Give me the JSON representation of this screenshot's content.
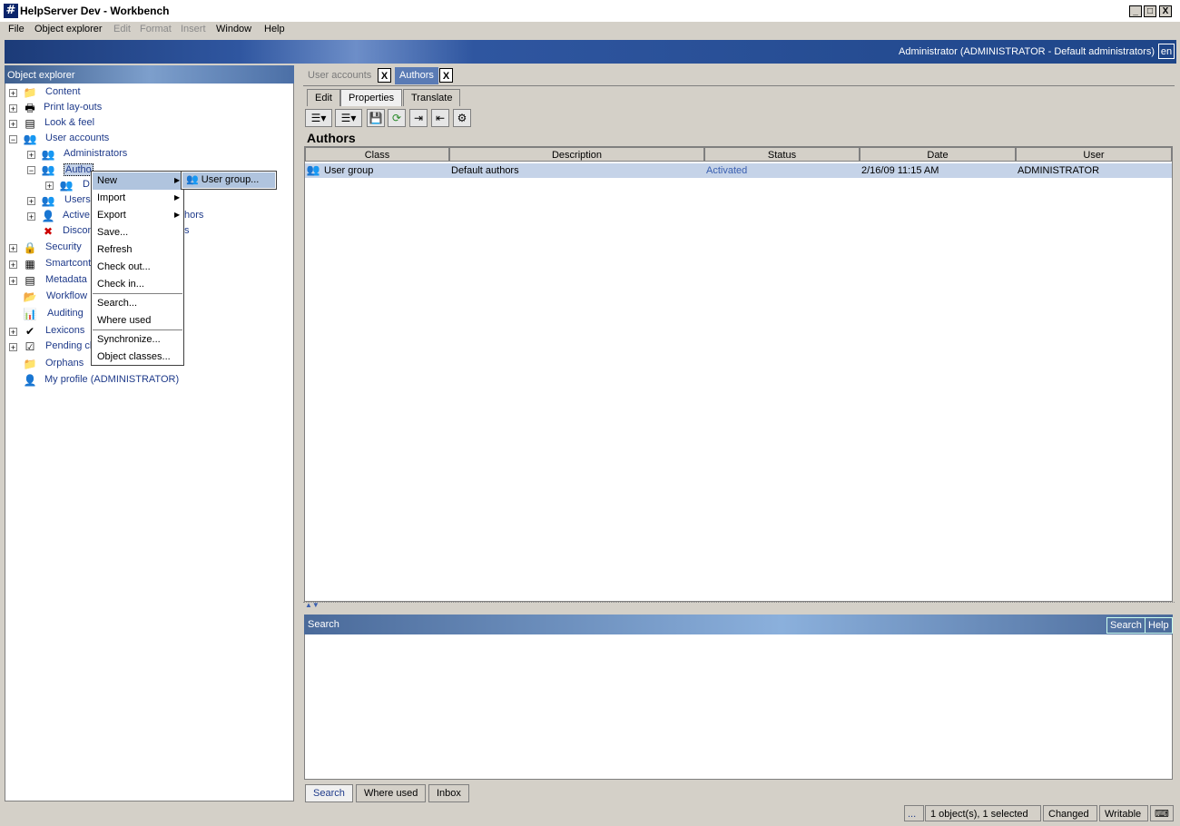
{
  "window": {
    "title": "HelpServer Dev - Workbench",
    "app_icon": "#",
    "min": "_",
    "max": "□",
    "close": "X"
  },
  "menubar": [
    {
      "label": "File",
      "enabled": true
    },
    {
      "label": "Object explorer",
      "enabled": true
    },
    {
      "label": "Edit",
      "enabled": false
    },
    {
      "label": "Format",
      "enabled": false
    },
    {
      "label": "Insert",
      "enabled": false
    },
    {
      "label": "Window",
      "enabled": true
    },
    {
      "label": "Help",
      "enabled": true
    }
  ],
  "banner": {
    "user": "Administrator (ADMINISTRATOR - Default administrators)",
    "lang": "en"
  },
  "explorer": {
    "title": "Object explorer",
    "items": [
      {
        "label": "Content"
      },
      {
        "label": "Print lay-outs"
      },
      {
        "label": "Look & feel"
      },
      {
        "label": "User accounts"
      },
      {
        "label": "Administrators"
      },
      {
        "label": "Autho"
      },
      {
        "label": "D"
      },
      {
        "label": "Users"
      },
      {
        "label": "Active"
      },
      {
        "label": "hors"
      },
      {
        "label": "Discon"
      },
      {
        "label": "s"
      },
      {
        "label": "Security"
      },
      {
        "label": "Smartcont"
      },
      {
        "label": "Metadata"
      },
      {
        "label": "Workflow"
      },
      {
        "label": "Auditing"
      },
      {
        "label": "Lexicons"
      },
      {
        "label": "Pending ch"
      },
      {
        "label": "Orphans"
      },
      {
        "label": "My profile (ADMINISTRATOR)"
      }
    ]
  },
  "context_menu": {
    "items": [
      "New",
      "Import",
      "Export",
      "Save...",
      "Refresh",
      "Check out...",
      "Check in...",
      "Search...",
      "Where used",
      "Synchronize...",
      "Object classes..."
    ],
    "submenu": "User group..."
  },
  "doc_tabs": [
    {
      "label": "User accounts",
      "close": "X"
    },
    {
      "label": "Authors",
      "close": "X"
    }
  ],
  "sub_tabs": [
    "Edit",
    "Properties",
    "Translate"
  ],
  "document": {
    "title": "Authors",
    "columns": [
      "Class",
      "Description",
      "Status",
      "Date",
      "User"
    ],
    "rows": [
      [
        "User group",
        "Default authors",
        "Activated",
        "2/16/09 11:15 AM",
        "ADMINISTRATOR"
      ]
    ]
  },
  "search": {
    "title": "Search",
    "search_btn": "Search",
    "help_btn": "Help"
  },
  "bottom_tabs": [
    "Search",
    "Where used",
    "Inbox"
  ],
  "status": {
    "dots": "...",
    "selection": "1 object(s), 1 selected",
    "changed": "Changed",
    "writable": "Writable"
  }
}
